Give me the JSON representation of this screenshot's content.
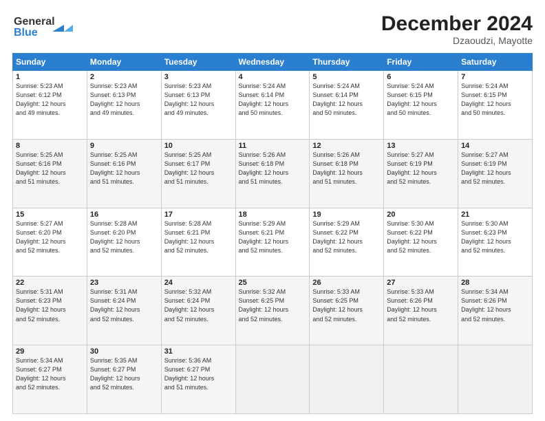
{
  "logo": {
    "line1": "General",
    "line2": "Blue"
  },
  "header": {
    "month": "December 2024",
    "location": "Dzaoudzi, Mayotte"
  },
  "weekdays": [
    "Sunday",
    "Monday",
    "Tuesday",
    "Wednesday",
    "Thursday",
    "Friday",
    "Saturday"
  ],
  "weeks": [
    [
      {
        "day": "1",
        "info": "Sunrise: 5:23 AM\nSunset: 6:12 PM\nDaylight: 12 hours\nand 49 minutes."
      },
      {
        "day": "2",
        "info": "Sunrise: 5:23 AM\nSunset: 6:13 PM\nDaylight: 12 hours\nand 49 minutes."
      },
      {
        "day": "3",
        "info": "Sunrise: 5:23 AM\nSunset: 6:13 PM\nDaylight: 12 hours\nand 49 minutes."
      },
      {
        "day": "4",
        "info": "Sunrise: 5:24 AM\nSunset: 6:14 PM\nDaylight: 12 hours\nand 50 minutes."
      },
      {
        "day": "5",
        "info": "Sunrise: 5:24 AM\nSunset: 6:14 PM\nDaylight: 12 hours\nand 50 minutes."
      },
      {
        "day": "6",
        "info": "Sunrise: 5:24 AM\nSunset: 6:15 PM\nDaylight: 12 hours\nand 50 minutes."
      },
      {
        "day": "7",
        "info": "Sunrise: 5:24 AM\nSunset: 6:15 PM\nDaylight: 12 hours\nand 50 minutes."
      }
    ],
    [
      {
        "day": "8",
        "info": "Sunrise: 5:25 AM\nSunset: 6:16 PM\nDaylight: 12 hours\nand 51 minutes."
      },
      {
        "day": "9",
        "info": "Sunrise: 5:25 AM\nSunset: 6:16 PM\nDaylight: 12 hours\nand 51 minutes."
      },
      {
        "day": "10",
        "info": "Sunrise: 5:25 AM\nSunset: 6:17 PM\nDaylight: 12 hours\nand 51 minutes."
      },
      {
        "day": "11",
        "info": "Sunrise: 5:26 AM\nSunset: 6:18 PM\nDaylight: 12 hours\nand 51 minutes."
      },
      {
        "day": "12",
        "info": "Sunrise: 5:26 AM\nSunset: 6:18 PM\nDaylight: 12 hours\nand 51 minutes."
      },
      {
        "day": "13",
        "info": "Sunrise: 5:27 AM\nSunset: 6:19 PM\nDaylight: 12 hours\nand 52 minutes."
      },
      {
        "day": "14",
        "info": "Sunrise: 5:27 AM\nSunset: 6:19 PM\nDaylight: 12 hours\nand 52 minutes."
      }
    ],
    [
      {
        "day": "15",
        "info": "Sunrise: 5:27 AM\nSunset: 6:20 PM\nDaylight: 12 hours\nand 52 minutes."
      },
      {
        "day": "16",
        "info": "Sunrise: 5:28 AM\nSunset: 6:20 PM\nDaylight: 12 hours\nand 52 minutes."
      },
      {
        "day": "17",
        "info": "Sunrise: 5:28 AM\nSunset: 6:21 PM\nDaylight: 12 hours\nand 52 minutes."
      },
      {
        "day": "18",
        "info": "Sunrise: 5:29 AM\nSunset: 6:21 PM\nDaylight: 12 hours\nand 52 minutes."
      },
      {
        "day": "19",
        "info": "Sunrise: 5:29 AM\nSunset: 6:22 PM\nDaylight: 12 hours\nand 52 minutes."
      },
      {
        "day": "20",
        "info": "Sunrise: 5:30 AM\nSunset: 6:22 PM\nDaylight: 12 hours\nand 52 minutes."
      },
      {
        "day": "21",
        "info": "Sunrise: 5:30 AM\nSunset: 6:23 PM\nDaylight: 12 hours\nand 52 minutes."
      }
    ],
    [
      {
        "day": "22",
        "info": "Sunrise: 5:31 AM\nSunset: 6:23 PM\nDaylight: 12 hours\nand 52 minutes."
      },
      {
        "day": "23",
        "info": "Sunrise: 5:31 AM\nSunset: 6:24 PM\nDaylight: 12 hours\nand 52 minutes."
      },
      {
        "day": "24",
        "info": "Sunrise: 5:32 AM\nSunset: 6:24 PM\nDaylight: 12 hours\nand 52 minutes."
      },
      {
        "day": "25",
        "info": "Sunrise: 5:32 AM\nSunset: 6:25 PM\nDaylight: 12 hours\nand 52 minutes."
      },
      {
        "day": "26",
        "info": "Sunrise: 5:33 AM\nSunset: 6:25 PM\nDaylight: 12 hours\nand 52 minutes."
      },
      {
        "day": "27",
        "info": "Sunrise: 5:33 AM\nSunset: 6:26 PM\nDaylight: 12 hours\nand 52 minutes."
      },
      {
        "day": "28",
        "info": "Sunrise: 5:34 AM\nSunset: 6:26 PM\nDaylight: 12 hours\nand 52 minutes."
      }
    ],
    [
      {
        "day": "29",
        "info": "Sunrise: 5:34 AM\nSunset: 6:27 PM\nDaylight: 12 hours\nand 52 minutes."
      },
      {
        "day": "30",
        "info": "Sunrise: 5:35 AM\nSunset: 6:27 PM\nDaylight: 12 hours\nand 52 minutes."
      },
      {
        "day": "31",
        "info": "Sunrise: 5:36 AM\nSunset: 6:27 PM\nDaylight: 12 hours\nand 51 minutes."
      },
      {
        "day": "",
        "info": ""
      },
      {
        "day": "",
        "info": ""
      },
      {
        "day": "",
        "info": ""
      },
      {
        "day": "",
        "info": ""
      }
    ]
  ]
}
